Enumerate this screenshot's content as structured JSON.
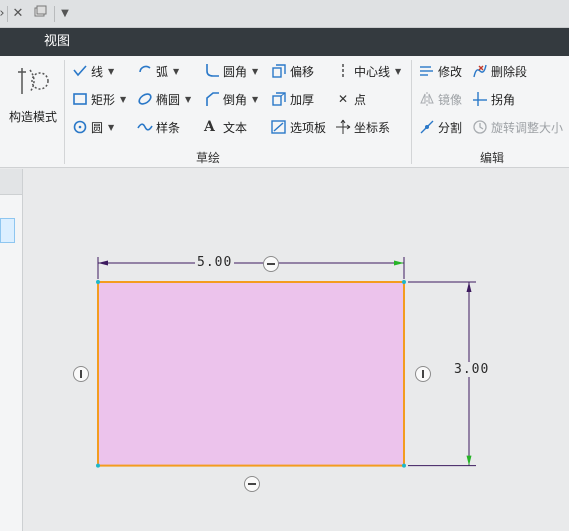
{
  "ribbon_tab": "视图",
  "ribbon": {
    "construct_mode": "构造模式",
    "sketch_group_label": "草绘",
    "edit_group_label": "编辑",
    "commands": {
      "line": "线",
      "arc": "弧",
      "fillet": "圆角",
      "offset": "偏移",
      "centerline": "中心线",
      "rectangle": "矩形",
      "ellipse": "椭圆",
      "chamfer": "倒角",
      "thicken": "加厚",
      "point": "点",
      "circle": "圆",
      "spline": "样条",
      "text": "文本",
      "palette": "选项板",
      "coordinate_system": "坐标系",
      "modify": "修改",
      "delete_segment": "删除段",
      "mirror": "镜像",
      "corner": "拐角",
      "divide": "分割",
      "rotate_resize": "旋转调整大小"
    }
  },
  "sketch": {
    "rectangle": {
      "width": 5.0,
      "height": 3.0,
      "fill": "#ecc3ec",
      "stroke": "#f39c1f"
    },
    "dimension_color": "#3d1b5f",
    "dim_width_text": "5.00",
    "dim_height_text": "3.00"
  },
  "colors": {
    "tab_bar": "#343a3f",
    "ribbon_bg": "#f4f5f6",
    "canvas_bg": "#e9eaeb",
    "icon_blue": "#2a78c8"
  }
}
